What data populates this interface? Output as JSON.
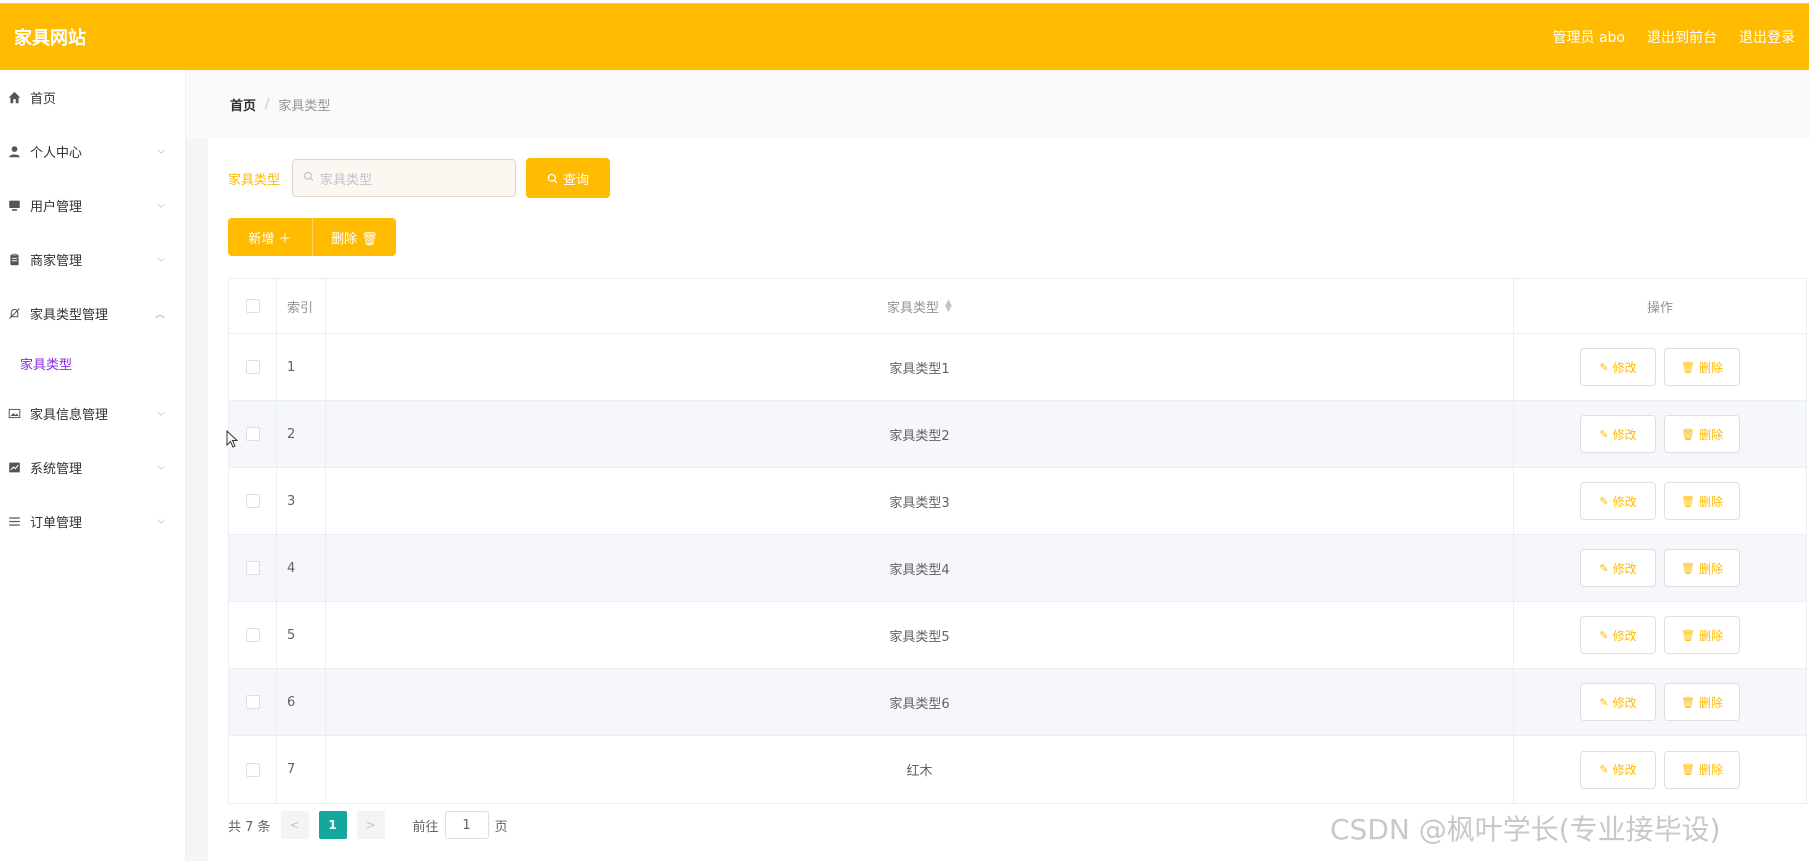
{
  "header": {
    "logo": "家具网站",
    "user_label": "管理员 abo",
    "exit_front": "退出到前台",
    "logout": "退出登录"
  },
  "sidebar": {
    "items": [
      {
        "label": "首页",
        "icon": "home-icon"
      },
      {
        "label": "个人中心",
        "icon": "user-icon"
      },
      {
        "label": "用户管理",
        "icon": "monitor-icon"
      },
      {
        "label": "商家管理",
        "icon": "clipboard-icon"
      },
      {
        "label": "家具类型管理",
        "icon": "bell-off-icon"
      },
      {
        "label": "家具信息管理",
        "icon": "picture-icon"
      },
      {
        "label": "系统管理",
        "icon": "chart-icon"
      },
      {
        "label": "订单管理",
        "icon": "list-icon"
      }
    ],
    "sub_item": "家具类型"
  },
  "breadcrumb": {
    "home": "首页",
    "sep": "/",
    "current": "家具类型"
  },
  "search": {
    "label": "家具类型",
    "placeholder": "家具类型",
    "button": "查询"
  },
  "actions": {
    "add": "新增 ＋",
    "delete": "删除 🗑"
  },
  "table": {
    "headers": {
      "index": "索引",
      "type": "家具类型",
      "ops": "操作"
    },
    "rows": [
      {
        "index": "1",
        "type": "家具类型1"
      },
      {
        "index": "2",
        "type": "家具类型2"
      },
      {
        "index": "3",
        "type": "家具类型3"
      },
      {
        "index": "4",
        "type": "家具类型4"
      },
      {
        "index": "5",
        "type": "家具类型5"
      },
      {
        "index": "6",
        "type": "家具类型6"
      },
      {
        "index": "7",
        "type": "红木"
      }
    ],
    "edit_label": "修改",
    "delete_label": "删除"
  },
  "pagination": {
    "total": "共 7 条",
    "prev": "<",
    "current": "1",
    "next": ">",
    "goto_label": "前往",
    "goto_value": "1",
    "page_suffix": "页"
  },
  "watermark": "CSDN @枫叶学长(专业接毕设)",
  "colors": {
    "primary": "#ffbb00",
    "pager_active": "#13a89e",
    "submenu_active": "#8a2be2"
  }
}
